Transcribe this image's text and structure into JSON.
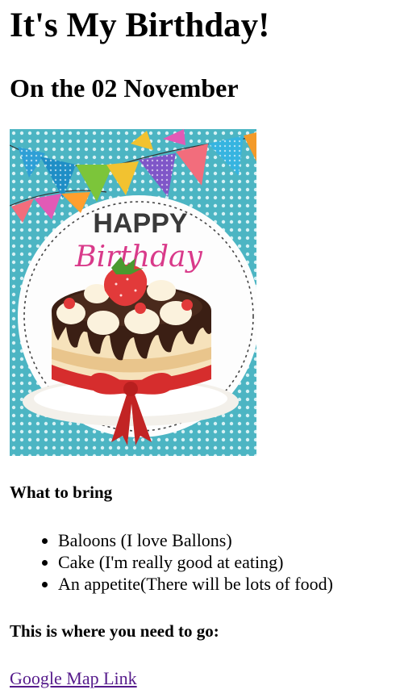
{
  "page": {
    "title": "It's My Birthday!",
    "subtitle": "On the 02 November"
  },
  "card": {
    "image_text_top": "HAPPY",
    "image_text_bottom": "Birthday",
    "colors": {
      "background_teal": "#4cb5c3",
      "circle_white": "#fdfdfd",
      "text_dark": "#3a3a3a",
      "text_pink": "#d93a8a",
      "chocolate": "#3b1f14",
      "cake_cream": "#f6e2bb",
      "ribbon_red": "#d62d2d",
      "strawberry": "#e23a3a"
    }
  },
  "bring": {
    "heading": "What to bring",
    "items": [
      "Baloons (I love Ballons)",
      "Cake (I'm really good at eating)",
      "An appetite(There will be lots of food)"
    ]
  },
  "directions": {
    "heading": "This is where you need to go:",
    "link_text": "Google Map Link"
  }
}
